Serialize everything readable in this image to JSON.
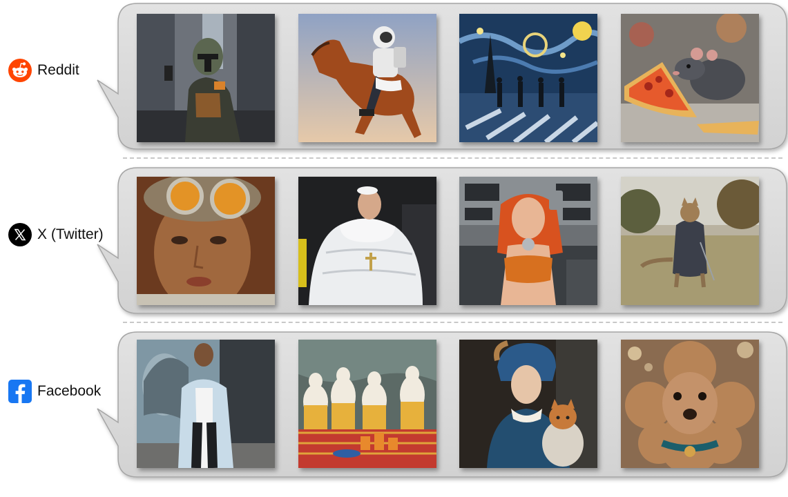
{
  "groups": [
    {
      "platform": "Reddit",
      "icon": "reddit-icon",
      "brand_color": "#FF4500",
      "images": [
        "armored-bounty-hunter-city-street",
        "astronaut-riding-horse",
        "starry-night-crosswalk-painting",
        "rat-eating-pizza-slice"
      ]
    },
    {
      "platform": "X (Twitter)",
      "icon": "x-logo-icon",
      "brand_color": "#000000",
      "images": [
        "woman-with-goggles-portrait",
        "pope-white-puffer-jacket",
        "red-haired-woman-retro-console",
        "cat-playing-golf"
      ]
    },
    {
      "platform": "Facebook",
      "icon": "facebook-icon",
      "brand_color": "#1877F2",
      "images": [
        "man-in-light-blue-raincoat",
        "goats-at-picnic-table",
        "girl-with-headscarf-and-cat",
        "poodle-with-collar"
      ]
    }
  ]
}
